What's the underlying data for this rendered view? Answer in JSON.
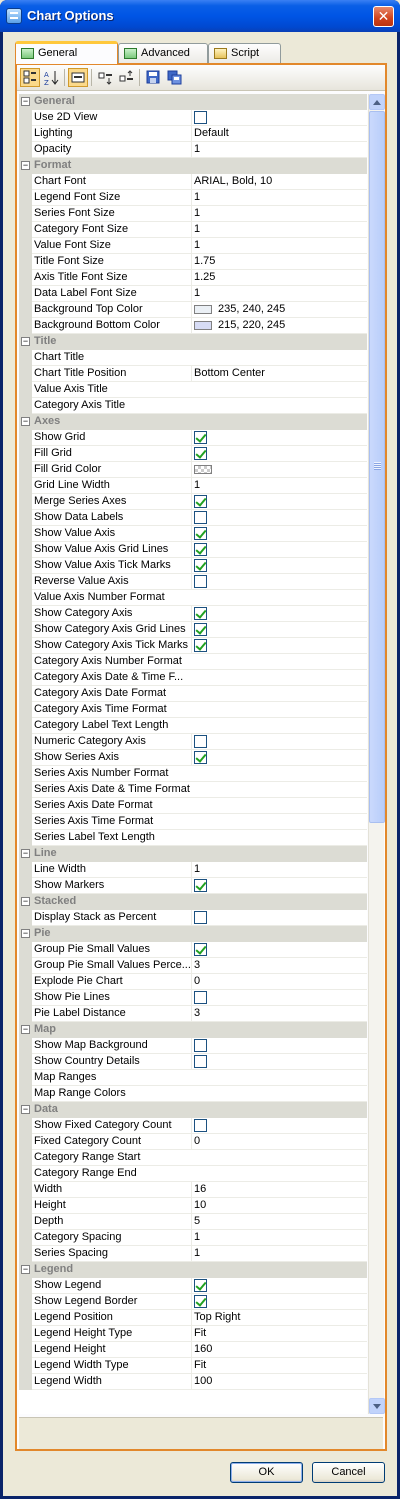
{
  "window": {
    "title": "Chart Options"
  },
  "tabs": [
    {
      "label": "General",
      "icon": "chart-icon",
      "active": true
    },
    {
      "label": "Advanced",
      "icon": "chart-icon",
      "active": false
    },
    {
      "label": "Script",
      "icon": "script-icon",
      "active": false
    }
  ],
  "toolbar": [
    "categorized-icon",
    "alphabetical-icon",
    "property-pages-icon",
    "expand-all-icon",
    "collapse-all-icon",
    "save-icon",
    "copy-icon"
  ],
  "grid": [
    {
      "type": "cat",
      "label": "General"
    },
    {
      "type": "prop",
      "name": "Use 2D View",
      "kind": "check",
      "checked": false
    },
    {
      "type": "prop",
      "name": "Lighting",
      "kind": "text",
      "value": "Default"
    },
    {
      "type": "prop",
      "name": "Opacity",
      "kind": "text",
      "value": "1"
    },
    {
      "type": "cat",
      "label": "Format"
    },
    {
      "type": "prop",
      "name": "Chart Font",
      "kind": "text",
      "value": "ARIAL, Bold, 10"
    },
    {
      "type": "prop",
      "name": "Legend Font Size",
      "kind": "text",
      "value": "1"
    },
    {
      "type": "prop",
      "name": "Series Font Size",
      "kind": "text",
      "value": "1"
    },
    {
      "type": "prop",
      "name": "Category Font Size",
      "kind": "text",
      "value": "1"
    },
    {
      "type": "prop",
      "name": "Value Font Size",
      "kind": "text",
      "value": "1"
    },
    {
      "type": "prop",
      "name": "Title Font Size",
      "kind": "text",
      "value": "1.75"
    },
    {
      "type": "prop",
      "name": "Axis Title Font Size",
      "kind": "text",
      "value": "1.25"
    },
    {
      "type": "prop",
      "name": "Data Label Font Size",
      "kind": "text",
      "value": "1"
    },
    {
      "type": "prop",
      "name": "Background Top Color",
      "kind": "color",
      "value": "235, 240, 245",
      "swatch": "#ebf0f5"
    },
    {
      "type": "prop",
      "name": "Background Bottom Color",
      "kind": "color",
      "value": "215, 220, 245",
      "swatch": "#d7dcf5"
    },
    {
      "type": "cat",
      "label": "Title"
    },
    {
      "type": "prop",
      "name": "Chart Title",
      "kind": "text",
      "value": ""
    },
    {
      "type": "prop",
      "name": "Chart Title Position",
      "kind": "text",
      "value": "Bottom Center"
    },
    {
      "type": "prop",
      "name": "Value Axis Title",
      "kind": "text",
      "value": ""
    },
    {
      "type": "prop",
      "name": "Category Axis Title",
      "kind": "text",
      "value": ""
    },
    {
      "type": "cat",
      "label": "Axes"
    },
    {
      "type": "prop",
      "name": "Show Grid",
      "kind": "check",
      "checked": true
    },
    {
      "type": "prop",
      "name": "Fill Grid",
      "kind": "check",
      "checked": true
    },
    {
      "type": "prop",
      "name": "Fill Grid Color",
      "kind": "color",
      "value": "",
      "swatch": "checker"
    },
    {
      "type": "prop",
      "name": "Grid Line Width",
      "kind": "text",
      "value": "1"
    },
    {
      "type": "prop",
      "name": "Merge Series Axes",
      "kind": "check",
      "checked": true
    },
    {
      "type": "prop",
      "name": "Show Data Labels",
      "kind": "check",
      "checked": false
    },
    {
      "type": "prop",
      "name": "Show Value Axis",
      "kind": "check",
      "checked": true
    },
    {
      "type": "prop",
      "name": "Show Value Axis Grid Lines",
      "kind": "check",
      "checked": true
    },
    {
      "type": "prop",
      "name": "Show Value Axis Tick Marks",
      "kind": "check",
      "checked": true
    },
    {
      "type": "prop",
      "name": "Reverse Value Axis",
      "kind": "check",
      "checked": false
    },
    {
      "type": "prop",
      "name": "Value Axis Number Format",
      "kind": "text",
      "value": ""
    },
    {
      "type": "prop",
      "name": "Show Category Axis",
      "kind": "check",
      "checked": true
    },
    {
      "type": "prop",
      "name": "Show Category Axis Grid Lines",
      "kind": "check",
      "checked": true
    },
    {
      "type": "prop",
      "name": "Show Category Axis Tick Marks",
      "kind": "check",
      "checked": true
    },
    {
      "type": "prop",
      "name": "Category Axis Number Format",
      "kind": "text",
      "value": ""
    },
    {
      "type": "prop",
      "name": "Category Axis Date & Time F...",
      "kind": "text",
      "value": ""
    },
    {
      "type": "prop",
      "name": "Category Axis Date Format",
      "kind": "text",
      "value": ""
    },
    {
      "type": "prop",
      "name": "Category Axis Time Format",
      "kind": "text",
      "value": ""
    },
    {
      "type": "prop",
      "name": "Category Label Text Length",
      "kind": "text",
      "value": ""
    },
    {
      "type": "prop",
      "name": "Numeric Category Axis",
      "kind": "check",
      "checked": false
    },
    {
      "type": "prop",
      "name": "Show Series Axis",
      "kind": "check",
      "checked": true
    },
    {
      "type": "prop",
      "name": "Series Axis Number Format",
      "kind": "text",
      "value": ""
    },
    {
      "type": "prop",
      "name": "Series Axis Date & Time Format",
      "kind": "text",
      "value": ""
    },
    {
      "type": "prop",
      "name": "Series Axis Date Format",
      "kind": "text",
      "value": ""
    },
    {
      "type": "prop",
      "name": "Series Axis Time Format",
      "kind": "text",
      "value": ""
    },
    {
      "type": "prop",
      "name": "Series Label Text Length",
      "kind": "text",
      "value": ""
    },
    {
      "type": "cat",
      "label": "Line"
    },
    {
      "type": "prop",
      "name": "Line Width",
      "kind": "text",
      "value": "1"
    },
    {
      "type": "prop",
      "name": "Show Markers",
      "kind": "check",
      "checked": true
    },
    {
      "type": "cat",
      "label": "Stacked"
    },
    {
      "type": "prop",
      "name": "Display Stack as Percent",
      "kind": "check",
      "checked": false
    },
    {
      "type": "cat",
      "label": "Pie"
    },
    {
      "type": "prop",
      "name": "Group Pie Small Values",
      "kind": "check",
      "checked": true
    },
    {
      "type": "prop",
      "name": "Group Pie Small Values Perce...",
      "kind": "text",
      "value": "3"
    },
    {
      "type": "prop",
      "name": "Explode Pie Chart",
      "kind": "text",
      "value": "0"
    },
    {
      "type": "prop",
      "name": "Show Pie Lines",
      "kind": "check",
      "checked": false
    },
    {
      "type": "prop",
      "name": "Pie Label Distance",
      "kind": "text",
      "value": "3"
    },
    {
      "type": "cat",
      "label": "Map"
    },
    {
      "type": "prop",
      "name": "Show Map Background",
      "kind": "check",
      "checked": false
    },
    {
      "type": "prop",
      "name": "Show Country Details",
      "kind": "check",
      "checked": false
    },
    {
      "type": "prop",
      "name": "Map Ranges",
      "kind": "text",
      "value": ""
    },
    {
      "type": "prop",
      "name": "Map Range Colors",
      "kind": "text",
      "value": ""
    },
    {
      "type": "cat",
      "label": "Data"
    },
    {
      "type": "prop",
      "name": "Show Fixed Category Count",
      "kind": "check",
      "checked": false
    },
    {
      "type": "prop",
      "name": "Fixed Category Count",
      "kind": "text",
      "value": "0"
    },
    {
      "type": "prop",
      "name": "Category Range Start",
      "kind": "text",
      "value": ""
    },
    {
      "type": "prop",
      "name": "Category Range End",
      "kind": "text",
      "value": ""
    },
    {
      "type": "prop",
      "name": "Width",
      "kind": "text",
      "value": "16"
    },
    {
      "type": "prop",
      "name": "Height",
      "kind": "text",
      "value": "10"
    },
    {
      "type": "prop",
      "name": "Depth",
      "kind": "text",
      "value": "5"
    },
    {
      "type": "prop",
      "name": "Category Spacing",
      "kind": "text",
      "value": "1"
    },
    {
      "type": "prop",
      "name": "Series Spacing",
      "kind": "text",
      "value": "1"
    },
    {
      "type": "cat",
      "label": "Legend"
    },
    {
      "type": "prop",
      "name": "Show Legend",
      "kind": "check",
      "checked": true
    },
    {
      "type": "prop",
      "name": "Show Legend Border",
      "kind": "check",
      "checked": true
    },
    {
      "type": "prop",
      "name": "Legend Position",
      "kind": "text",
      "value": "Top Right"
    },
    {
      "type": "prop",
      "name": "Legend Height Type",
      "kind": "text",
      "value": "Fit"
    },
    {
      "type": "prop",
      "name": "Legend Height",
      "kind": "text",
      "value": "160"
    },
    {
      "type": "prop",
      "name": "Legend Width Type",
      "kind": "text",
      "value": "Fit"
    },
    {
      "type": "prop",
      "name": "Legend Width",
      "kind": "text",
      "value": "100"
    }
  ],
  "buttons": {
    "ok": "OK",
    "cancel": "Cancel"
  },
  "colors": {
    "titlebar": "#0055e5",
    "tab_highlight": "#ffc83c",
    "panel_border": "#e2882b",
    "check_mark": "#21a121"
  }
}
